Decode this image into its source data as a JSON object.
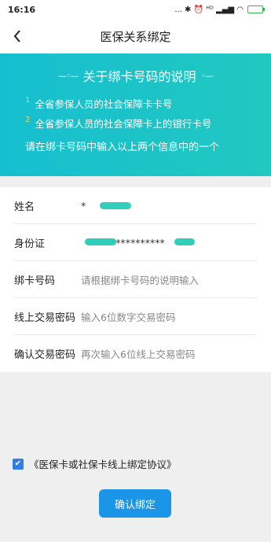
{
  "status_bar": {
    "time": "16:16",
    "icons_text": "... ✱ ⏰ ᴴᴰ ▂▄▆ ◠",
    "battery_label": ""
  },
  "nav": {
    "title": "医保关系绑定",
    "back_icon": "chevron-left-icon"
  },
  "banner": {
    "title": "关于绑卡号码的说明",
    "rules": [
      {
        "num": "1",
        "text": "全省参保人员的社会保障卡卡号"
      },
      {
        "num": "2",
        "text": "全省参保人员的社会保障卡上的银行卡号"
      }
    ],
    "note": "请在绑卡号码中输入以上两个信息中的一个"
  },
  "form": {
    "name": {
      "label": "姓名",
      "value": "*"
    },
    "id_card": {
      "label": "身份证",
      "value": "***********"
    },
    "card_number": {
      "label": "绑卡号码",
      "placeholder": "请根据绑卡号码的说明输入"
    },
    "online_password": {
      "label": "线上交易密码",
      "placeholder": "输入6位数字交易密码"
    },
    "confirm_password": {
      "label": "确认交易密码",
      "placeholder": "再次输入6位线上交易密码"
    }
  },
  "agreement": {
    "checked": true,
    "text": "《医保卡或社保卡线上绑定协议》"
  },
  "submit": {
    "label": "确认绑定"
  },
  "colors": {
    "banner": "#1ec3c8",
    "button": "#1a95e8",
    "checkbox": "#2f7fe0",
    "mask": "#27cbb5"
  }
}
